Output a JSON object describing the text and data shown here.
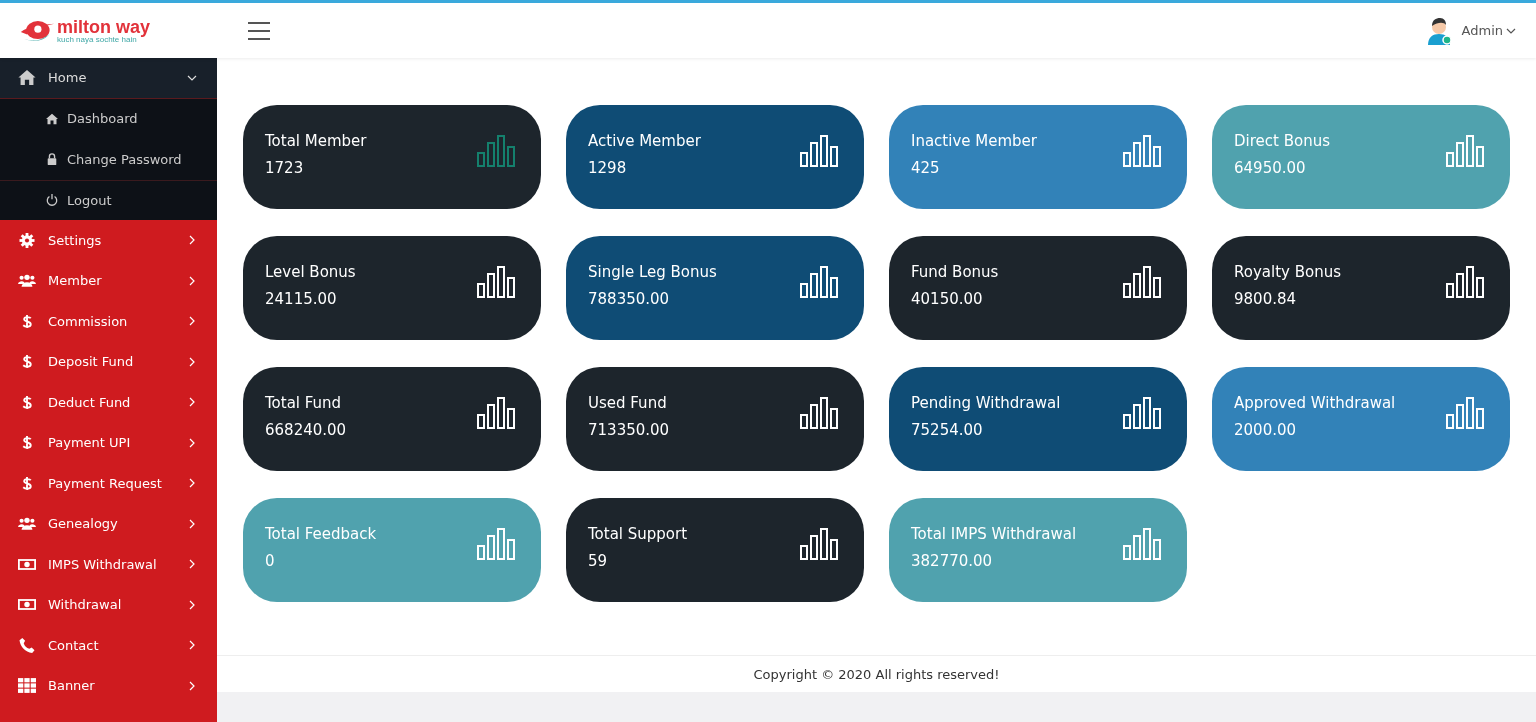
{
  "brand": {
    "name": "milton way",
    "tagline": "kuch naya sochte hain"
  },
  "header": {
    "user": "Admin"
  },
  "sidebar": {
    "items": [
      {
        "label": "Home",
        "kind": "home",
        "expanded": true,
        "children": [
          {
            "label": "Dashboard",
            "kind": "home"
          },
          {
            "label": "Change Password",
            "kind": "lock"
          },
          {
            "label": "Logout",
            "kind": "power"
          }
        ]
      },
      {
        "label": "Settings",
        "kind": "gear",
        "expanded": false
      },
      {
        "label": "Member",
        "kind": "users",
        "expanded": false
      },
      {
        "label": "Commission",
        "kind": "dollar",
        "expanded": false
      },
      {
        "label": "Deposit Fund",
        "kind": "dollar",
        "expanded": false
      },
      {
        "label": "Deduct Fund",
        "kind": "dollar",
        "expanded": false
      },
      {
        "label": "Payment UPI",
        "kind": "dollar",
        "expanded": false
      },
      {
        "label": "Payment Request",
        "kind": "dollar",
        "expanded": false
      },
      {
        "label": "Genealogy",
        "kind": "users",
        "expanded": false
      },
      {
        "label": "IMPS Withdrawal",
        "kind": "money",
        "expanded": false
      },
      {
        "label": "Withdrawal",
        "kind": "money",
        "expanded": false
      },
      {
        "label": "Contact",
        "kind": "phone",
        "expanded": false
      },
      {
        "label": "Banner",
        "kind": "grid",
        "expanded": false
      }
    ]
  },
  "cards": [
    {
      "title": "Total Member",
      "value": "1723",
      "color": "#1d252c"
    },
    {
      "title": "Active Member",
      "value": "1298",
      "color": "#0f4c75"
    },
    {
      "title": "Inactive Member",
      "value": "425",
      "color": "#3282b8"
    },
    {
      "title": "Direct Bonus",
      "value": "64950.00",
      "color": "#50a2ae"
    },
    {
      "title": "Level Bonus",
      "value": "24115.00",
      "color": "#1d252c"
    },
    {
      "title": "Single Leg Bonus",
      "value": "788350.00",
      "color": "#0f4c75"
    },
    {
      "title": "Fund Bonus",
      "value": "40150.00",
      "color": "#1d252c"
    },
    {
      "title": "Royalty Bonus",
      "value": "9800.84",
      "color": "#1d252c"
    },
    {
      "title": "Total Fund",
      "value": "668240.00",
      "color": "#1d252c"
    },
    {
      "title": "Used Fund",
      "value": "713350.00",
      "color": "#1d252c"
    },
    {
      "title": "Pending Withdrawal",
      "value": "75254.00",
      "color": "#0f4c75"
    },
    {
      "title": "Approved Withdrawal",
      "value": "2000.00",
      "color": "#3282b8"
    },
    {
      "title": "Total Feedback",
      "value": "0",
      "color": "#50a2ae"
    },
    {
      "title": "Total Support",
      "value": "59",
      "color": "#1d252c"
    },
    {
      "title": "Total IMPS Withdrawal",
      "value": "382770.00",
      "color": "#50a2ae"
    }
  ],
  "footer": {
    "text": "Copyright © 2020 All rights reserved!"
  }
}
